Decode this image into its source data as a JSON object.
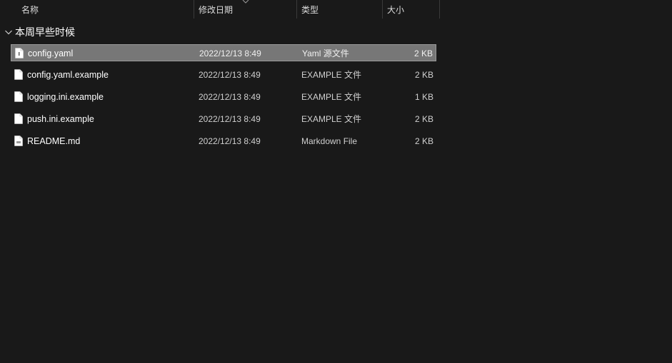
{
  "columns": {
    "name": "名称",
    "date": "修改日期",
    "type": "类型",
    "size": "大小"
  },
  "group": {
    "label": "本周早些时候"
  },
  "files": [
    {
      "name": "config.yaml",
      "date": "2022/12/13 8:49",
      "type": "Yaml 源文件",
      "size": "2 KB",
      "icon": "yaml-file-icon",
      "selected": true
    },
    {
      "name": "config.yaml.example",
      "date": "2022/12/13 8:49",
      "type": "EXAMPLE 文件",
      "size": "2 KB",
      "icon": "file-icon",
      "selected": false
    },
    {
      "name": "logging.ini.example",
      "date": "2022/12/13 8:49",
      "type": "EXAMPLE 文件",
      "size": "1 KB",
      "icon": "file-icon",
      "selected": false
    },
    {
      "name": "push.ini.example",
      "date": "2022/12/13 8:49",
      "type": "EXAMPLE 文件",
      "size": "2 KB",
      "icon": "file-icon",
      "selected": false
    },
    {
      "name": "README.md",
      "date": "2022/12/13 8:49",
      "type": "Markdown File",
      "size": "2 KB",
      "icon": "markdown-file-icon",
      "selected": false
    }
  ],
  "colors": {
    "background": "#191919",
    "selection": "#777777"
  }
}
